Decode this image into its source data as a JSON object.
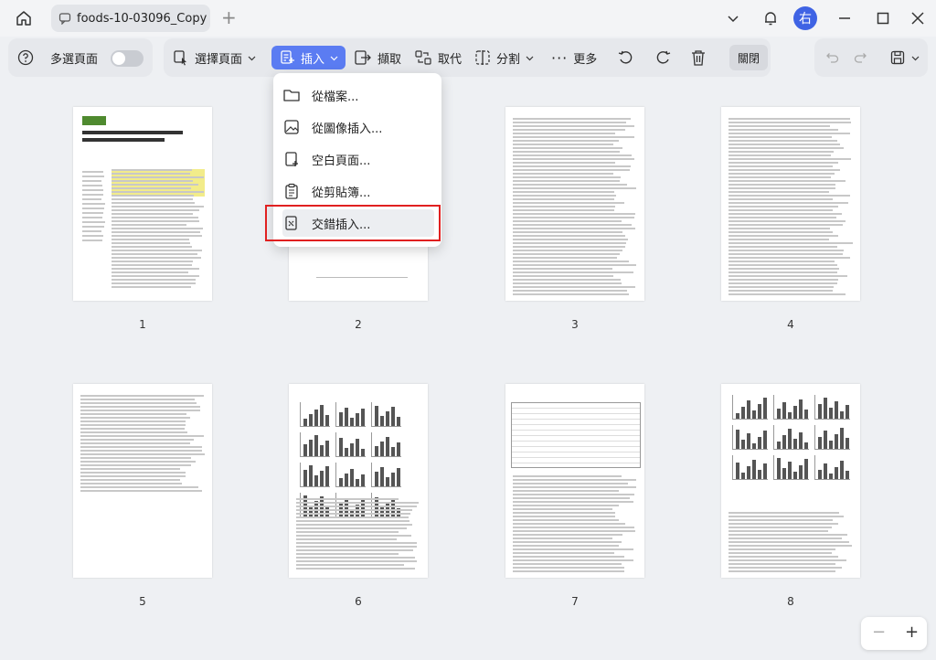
{
  "tab": {
    "title": "foods-10-03096_Copy"
  },
  "titlebar": {
    "avatar_text": "右"
  },
  "toolbar": {
    "multi_page_label": "多選頁面",
    "select_page_label": "選擇頁面",
    "insert_label": "插入",
    "extract_label": "擷取",
    "replace_label": "取代",
    "split_label": "分割",
    "more_label": "更多",
    "close_label": "關閉"
  },
  "insert_menu": {
    "items": [
      {
        "label": "從檔案..."
      },
      {
        "label": "從圖像插入..."
      },
      {
        "label": "空白頁面..."
      },
      {
        "label": "從剪貼簿..."
      },
      {
        "label": "交錯插入..."
      }
    ]
  },
  "pages": [
    {
      "number": "1"
    },
    {
      "number": "2"
    },
    {
      "number": "3"
    },
    {
      "number": "4"
    },
    {
      "number": "5"
    },
    {
      "number": "6"
    },
    {
      "number": "7"
    },
    {
      "number": "8"
    }
  ],
  "zoom": {
    "minus": "−",
    "plus": "+"
  }
}
